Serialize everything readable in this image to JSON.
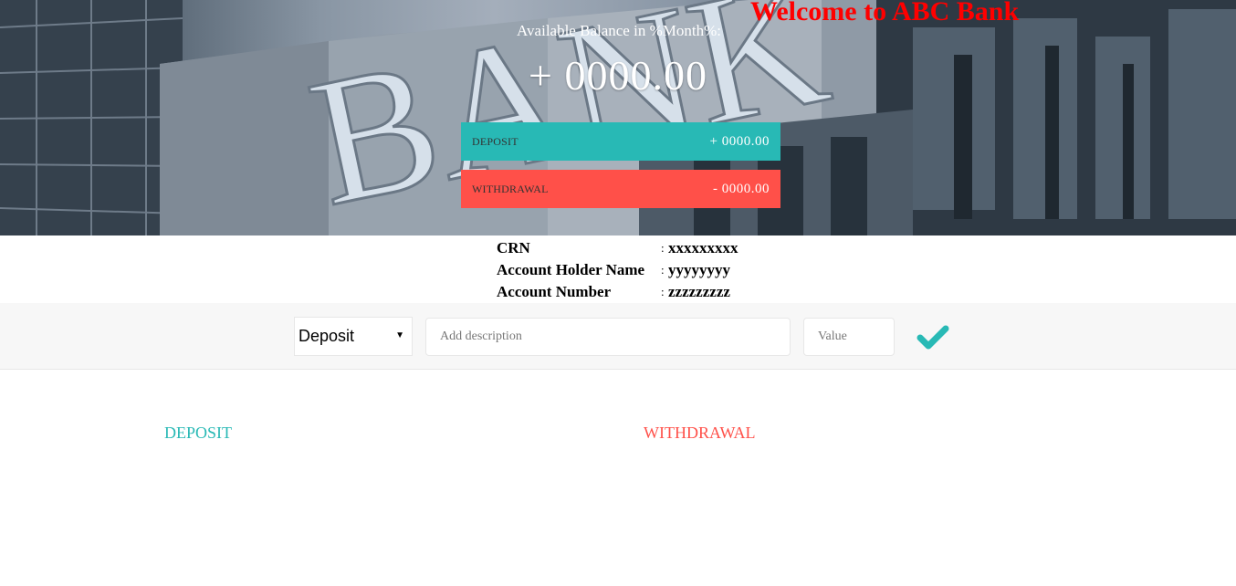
{
  "header": {
    "welcome": "Welcome to ABC Bank",
    "available_label": "Available Balance in %Month%:",
    "available_value": "+ 0000.00"
  },
  "summary": {
    "deposit_label": "DEPOSIT",
    "deposit_value": "+ 0000.00",
    "withdrawal_label": "WITHDRAWAL",
    "withdrawal_value": "- 0000.00"
  },
  "account": {
    "crn_label": "CRN",
    "crn_value": "xxxxxxxxx",
    "holder_label": "Account Holder Name",
    "holder_value": "yyyyyyyy",
    "number_label": "Account Number",
    "number_value": "zzzzzzzzz",
    "separator": ":"
  },
  "add_form": {
    "type_selected": "Deposit",
    "description_placeholder": "Add description",
    "value_placeholder": "Value",
    "submit_icon": "checkmark-icon"
  },
  "lists": {
    "deposit_title": "DEPOSIT",
    "withdrawal_title": "WITHDRAWAL"
  },
  "colors": {
    "deposit": "#28b9b5",
    "withdrawal": "#ff5049",
    "welcome": "#ff0000"
  }
}
